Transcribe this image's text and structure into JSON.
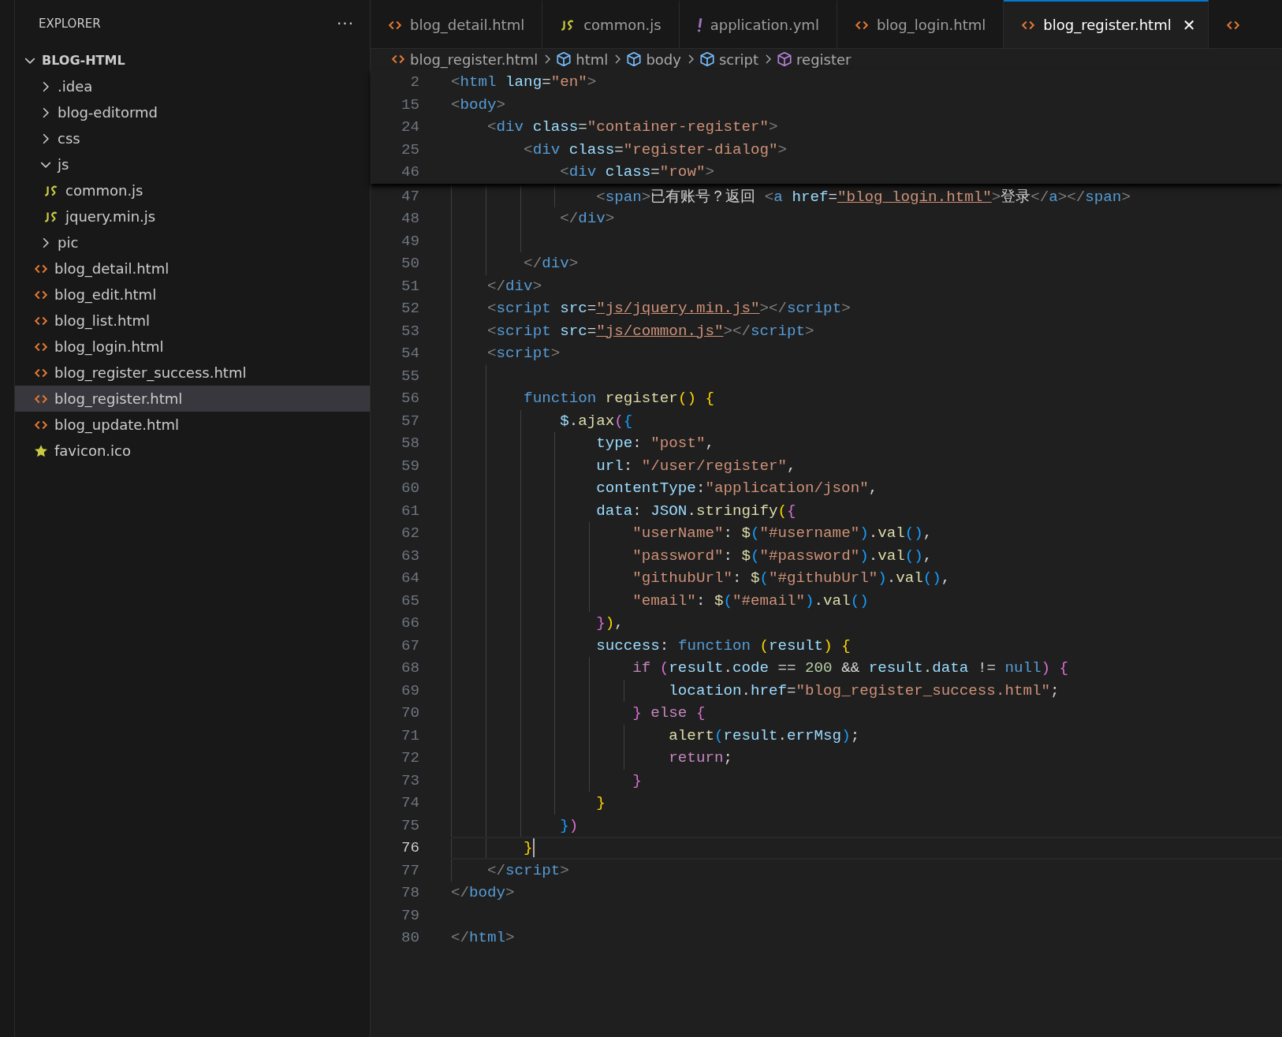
{
  "sidebar": {
    "title": "EXPLORER",
    "more": "···",
    "tree": [
      {
        "label": "BLOG-HTML",
        "kind": "root",
        "expanded": true,
        "selected": false,
        "children": [
          {
            "label": ".idea",
            "kind": "folder",
            "expanded": false,
            "selected": false
          },
          {
            "label": "blog-editormd",
            "kind": "folder",
            "expanded": false,
            "selected": false
          },
          {
            "label": "css",
            "kind": "folder",
            "expanded": false,
            "selected": false
          },
          {
            "label": "js",
            "kind": "folder",
            "expanded": true,
            "selected": false,
            "children": [
              {
                "label": "common.js",
                "kind": "js",
                "selected": false
              },
              {
                "label": "jquery.min.js",
                "kind": "js",
                "selected": false
              }
            ]
          },
          {
            "label": "pic",
            "kind": "folder",
            "expanded": false,
            "selected": false
          },
          {
            "label": "blog_detail.html",
            "kind": "html",
            "selected": false
          },
          {
            "label": "blog_edit.html",
            "kind": "html",
            "selected": false
          },
          {
            "label": "blog_list.html",
            "kind": "html",
            "selected": false
          },
          {
            "label": "blog_login.html",
            "kind": "html",
            "selected": false
          },
          {
            "label": "blog_register_success.html",
            "kind": "html",
            "selected": false
          },
          {
            "label": "blog_register.html",
            "kind": "html",
            "selected": true
          },
          {
            "label": "blog_update.html",
            "kind": "html",
            "selected": false
          },
          {
            "label": "favicon.ico",
            "kind": "star",
            "selected": false
          }
        ]
      }
    ]
  },
  "tabs": [
    {
      "label": "blog_detail.html",
      "kind": "html",
      "selected": false
    },
    {
      "label": "common.js",
      "kind": "js",
      "selected": false
    },
    {
      "label": "application.yml",
      "kind": "yaml",
      "selected": false
    },
    {
      "label": "blog_login.html",
      "kind": "html",
      "selected": false
    },
    {
      "label": "blog_register.html",
      "kind": "html",
      "selected": true,
      "close": "✕"
    },
    {
      "kind": "html",
      "selected": false
    }
  ],
  "breadcrumbs": [
    {
      "label": "blog_register.html",
      "kind": "html"
    },
    {
      "label": "html",
      "kind": "module"
    },
    {
      "label": "body",
      "kind": "module"
    },
    {
      "label": "script",
      "kind": "module"
    },
    {
      "label": "register",
      "kind": "function"
    }
  ],
  "sticky_lines": [
    {
      "number": "2",
      "tokens": [
        {
          "kind": "punct",
          "text": "<"
        },
        {
          "kind": "tag",
          "text": "html"
        },
        {
          "kind": "attr",
          "text": " lang"
        },
        {
          "kind": "text",
          "text": "="
        },
        {
          "kind": "str",
          "text": "\"en\""
        },
        {
          "kind": "punct",
          "text": ">"
        }
      ]
    },
    {
      "number": "15",
      "tokens": [
        {
          "kind": "punct",
          "text": "<"
        },
        {
          "kind": "tag",
          "text": "body"
        },
        {
          "kind": "punct",
          "text": ">"
        }
      ]
    },
    {
      "number": "24",
      "tokens": [
        {
          "kind": "punct",
          "text": "    <"
        },
        {
          "kind": "tag",
          "text": "div"
        },
        {
          "kind": "attr",
          "text": " class"
        },
        {
          "kind": "text",
          "text": "="
        },
        {
          "kind": "str",
          "text": "\"container-register\""
        },
        {
          "kind": "punct",
          "text": ">"
        }
      ]
    },
    {
      "number": "25",
      "tokens": [
        {
          "kind": "punct",
          "text": "        <"
        },
        {
          "kind": "tag",
          "text": "div"
        },
        {
          "kind": "attr",
          "text": " class"
        },
        {
          "kind": "text",
          "text": "="
        },
        {
          "kind": "str",
          "text": "\"register-dialog\""
        },
        {
          "kind": "punct",
          "text": ">"
        }
      ]
    },
    {
      "number": "46",
      "tokens": [
        {
          "kind": "punct",
          "text": "            <"
        },
        {
          "kind": "tag",
          "text": "div"
        },
        {
          "kind": "attr",
          "text": " class"
        },
        {
          "kind": "text",
          "text": "="
        },
        {
          "kind": "str",
          "text": "\"row\""
        },
        {
          "kind": "punct",
          "text": ">"
        }
      ]
    }
  ],
  "lines": [
    {
      "number": "47",
      "current": false,
      "tokens": [
        {
          "kind": "punct",
          "text": "                <"
        },
        {
          "kind": "tag",
          "text": "span"
        },
        {
          "kind": "punct",
          "text": ">"
        },
        {
          "kind": "text",
          "text": "已有账号？返回 "
        },
        {
          "kind": "punct",
          "text": "<"
        },
        {
          "kind": "tag",
          "text": "a"
        },
        {
          "kind": "attr",
          "text": " href"
        },
        {
          "kind": "text",
          "text": "="
        },
        {
          "kind": "link",
          "text": "\"blog_login.html\""
        },
        {
          "kind": "punct",
          "text": ">"
        },
        {
          "kind": "text",
          "text": "登录"
        },
        {
          "kind": "punct",
          "text": "</"
        },
        {
          "kind": "tag",
          "text": "a"
        },
        {
          "kind": "punct",
          "text": "></"
        },
        {
          "kind": "tag",
          "text": "span"
        },
        {
          "kind": "punct",
          "text": ">"
        }
      ]
    },
    {
      "number": "48",
      "current": false,
      "tokens": [
        {
          "kind": "punct",
          "text": "            </"
        },
        {
          "kind": "tag",
          "text": "div"
        },
        {
          "kind": "punct",
          "text": ">"
        }
      ]
    },
    {
      "number": "49",
      "current": false
    },
    {
      "number": "50",
      "current": false,
      "tokens": [
        {
          "kind": "punct",
          "text": "        </"
        },
        {
          "kind": "tag",
          "text": "div"
        },
        {
          "kind": "punct",
          "text": ">"
        }
      ]
    },
    {
      "number": "51",
      "current": false,
      "tokens": [
        {
          "kind": "punct",
          "text": "    </"
        },
        {
          "kind": "tag",
          "text": "div"
        },
        {
          "kind": "punct",
          "text": ">"
        }
      ]
    },
    {
      "number": "52",
      "current": false,
      "tokens": [
        {
          "kind": "punct",
          "text": "    <"
        },
        {
          "kind": "tag",
          "text": "script"
        },
        {
          "kind": "attr",
          "text": " src"
        },
        {
          "kind": "text",
          "text": "="
        },
        {
          "kind": "link",
          "text": "\"js/jquery.min.js\""
        },
        {
          "kind": "punct",
          "text": "></"
        },
        {
          "kind": "tag",
          "text": "script"
        },
        {
          "kind": "punct",
          "text": ">"
        }
      ]
    },
    {
      "number": "53",
      "current": false,
      "tokens": [
        {
          "kind": "punct",
          "text": "    <"
        },
        {
          "kind": "tag",
          "text": "script"
        },
        {
          "kind": "attr",
          "text": " src"
        },
        {
          "kind": "text",
          "text": "="
        },
        {
          "kind": "link",
          "text": "\"js/common.js\""
        },
        {
          "kind": "punct",
          "text": "></"
        },
        {
          "kind": "tag",
          "text": "script"
        },
        {
          "kind": "punct",
          "text": ">"
        }
      ]
    },
    {
      "number": "54",
      "current": false,
      "tokens": [
        {
          "kind": "punct",
          "text": "    <"
        },
        {
          "kind": "tag",
          "text": "script"
        },
        {
          "kind": "punct",
          "text": ">"
        }
      ]
    },
    {
      "number": "55",
      "current": false
    },
    {
      "number": "56",
      "current": false,
      "tokens": [
        {
          "kind": "kw",
          "text": "        function"
        },
        {
          "kind": "fn",
          "text": " register"
        },
        {
          "kind": "b1",
          "text": "()"
        },
        {
          "kind": "b1",
          "text": " {"
        }
      ]
    },
    {
      "number": "57",
      "current": false,
      "tokens": [
        {
          "kind": "var",
          "text": "            $"
        },
        {
          "kind": "text",
          "text": "."
        },
        {
          "kind": "fn",
          "text": "ajax"
        },
        {
          "kind": "b2",
          "text": "("
        },
        {
          "kind": "b3",
          "text": "{"
        }
      ]
    },
    {
      "number": "58",
      "current": false,
      "tokens": [
        {
          "kind": "var",
          "text": "                type"
        },
        {
          "kind": "text",
          "text": ": "
        },
        {
          "kind": "str",
          "text": "\"post\""
        },
        {
          "kind": "text",
          "text": ","
        }
      ]
    },
    {
      "number": "59",
      "current": false,
      "tokens": [
        {
          "kind": "var",
          "text": "                url"
        },
        {
          "kind": "text",
          "text": ": "
        },
        {
          "kind": "str",
          "text": "\"/user/register\""
        },
        {
          "kind": "text",
          "text": ","
        }
      ]
    },
    {
      "number": "60",
      "current": false,
      "tokens": [
        {
          "kind": "var",
          "text": "                contentType"
        },
        {
          "kind": "text",
          "text": ":"
        },
        {
          "kind": "str",
          "text": "\"application/json\""
        },
        {
          "kind": "text",
          "text": ","
        }
      ]
    },
    {
      "number": "61",
      "current": false,
      "tokens": [
        {
          "kind": "var",
          "text": "                data"
        },
        {
          "kind": "text",
          "text": ": "
        },
        {
          "kind": "var",
          "text": "JSON"
        },
        {
          "kind": "text",
          "text": "."
        },
        {
          "kind": "fn",
          "text": "stringify"
        },
        {
          "kind": "b1",
          "text": "("
        },
        {
          "kind": "b2",
          "text": "{"
        }
      ]
    },
    {
      "number": "62",
      "current": false,
      "tokens": [
        {
          "kind": "str",
          "text": "                    \"userName\""
        },
        {
          "kind": "text",
          "text": ": "
        },
        {
          "kind": "fn",
          "text": "$"
        },
        {
          "kind": "b3",
          "text": "("
        },
        {
          "kind": "str",
          "text": "\"#username\""
        },
        {
          "kind": "b3",
          "text": ")"
        },
        {
          "kind": "text",
          "text": "."
        },
        {
          "kind": "fn",
          "text": "val"
        },
        {
          "kind": "b3",
          "text": "()"
        },
        {
          "kind": "text",
          "text": ","
        }
      ]
    },
    {
      "number": "63",
      "current": false,
      "tokens": [
        {
          "kind": "str",
          "text": "                    \"password\""
        },
        {
          "kind": "text",
          "text": ": "
        },
        {
          "kind": "fn",
          "text": "$"
        },
        {
          "kind": "b3",
          "text": "("
        },
        {
          "kind": "str",
          "text": "\"#password\""
        },
        {
          "kind": "b3",
          "text": ")"
        },
        {
          "kind": "text",
          "text": "."
        },
        {
          "kind": "fn",
          "text": "val"
        },
        {
          "kind": "b3",
          "text": "()"
        },
        {
          "kind": "text",
          "text": ","
        }
      ]
    },
    {
      "number": "64",
      "current": false,
      "tokens": [
        {
          "kind": "str",
          "text": "                    \"githubUrl\""
        },
        {
          "kind": "text",
          "text": ": "
        },
        {
          "kind": "fn",
          "text": "$"
        },
        {
          "kind": "b3",
          "text": "("
        },
        {
          "kind": "str",
          "text": "\"#githubUrl\""
        },
        {
          "kind": "b3",
          "text": ")"
        },
        {
          "kind": "text",
          "text": "."
        },
        {
          "kind": "fn",
          "text": "val"
        },
        {
          "kind": "b3",
          "text": "()"
        },
        {
          "kind": "text",
          "text": ","
        }
      ]
    },
    {
      "number": "65",
      "current": false,
      "tokens": [
        {
          "kind": "str",
          "text": "                    \"email\""
        },
        {
          "kind": "text",
          "text": ": "
        },
        {
          "kind": "fn",
          "text": "$"
        },
        {
          "kind": "b3",
          "text": "("
        },
        {
          "kind": "str",
          "text": "\"#email\""
        },
        {
          "kind": "b3",
          "text": ")"
        },
        {
          "kind": "text",
          "text": "."
        },
        {
          "kind": "fn",
          "text": "val"
        },
        {
          "kind": "b3",
          "text": "()"
        }
      ]
    },
    {
      "number": "66",
      "current": false,
      "tokens": [
        {
          "kind": "b2",
          "text": "                }"
        },
        {
          "kind": "b1",
          "text": ")"
        },
        {
          "kind": "text",
          "text": ","
        }
      ]
    },
    {
      "number": "67",
      "current": false,
      "tokens": [
        {
          "kind": "var",
          "text": "                success"
        },
        {
          "kind": "text",
          "text": ": "
        },
        {
          "kind": "kw",
          "text": "function"
        },
        {
          "kind": "b1",
          "text": " ("
        },
        {
          "kind": "var",
          "text": "result"
        },
        {
          "kind": "b1",
          "text": ")"
        },
        {
          "kind": "b1",
          "text": " {"
        }
      ]
    },
    {
      "number": "68",
      "current": false,
      "tokens": [
        {
          "kind": "ctrl",
          "text": "                    if"
        },
        {
          "kind": "b2",
          "text": " ("
        },
        {
          "kind": "var",
          "text": "result"
        },
        {
          "kind": "text",
          "text": "."
        },
        {
          "kind": "var",
          "text": "code"
        },
        {
          "kind": "text",
          "text": " == "
        },
        {
          "kind": "num",
          "text": "200"
        },
        {
          "kind": "text",
          "text": " && "
        },
        {
          "kind": "var",
          "text": "result"
        },
        {
          "kind": "text",
          "text": "."
        },
        {
          "kind": "var",
          "text": "data"
        },
        {
          "kind": "text",
          "text": " != "
        },
        {
          "kind": "kw",
          "text": "null"
        },
        {
          "kind": "b2",
          "text": ")"
        },
        {
          "kind": "b2",
          "text": " {"
        }
      ]
    },
    {
      "number": "69",
      "current": false,
      "tokens": [
        {
          "kind": "var",
          "text": "                        location"
        },
        {
          "kind": "text",
          "text": "."
        },
        {
          "kind": "var",
          "text": "href"
        },
        {
          "kind": "text",
          "text": "="
        },
        {
          "kind": "str",
          "text": "\"blog_register_success.html\""
        },
        {
          "kind": "text",
          "text": ";"
        }
      ]
    },
    {
      "number": "70",
      "current": false,
      "tokens": [
        {
          "kind": "b2",
          "text": "                    }"
        },
        {
          "kind": "ctrl",
          "text": " else"
        },
        {
          "kind": "b2",
          "text": " {"
        }
      ]
    },
    {
      "number": "71",
      "current": false,
      "tokens": [
        {
          "kind": "fn",
          "text": "                        alert"
        },
        {
          "kind": "b3",
          "text": "("
        },
        {
          "kind": "var",
          "text": "result"
        },
        {
          "kind": "text",
          "text": "."
        },
        {
          "kind": "var",
          "text": "errMsg"
        },
        {
          "kind": "b3",
          "text": ")"
        },
        {
          "kind": "text",
          "text": ";"
        }
      ]
    },
    {
      "number": "72",
      "current": false,
      "tokens": [
        {
          "kind": "ctrl",
          "text": "                        return"
        },
        {
          "kind": "text",
          "text": ";"
        }
      ]
    },
    {
      "number": "73",
      "current": false,
      "tokens": [
        {
          "kind": "b2",
          "text": "                    }"
        }
      ]
    },
    {
      "number": "74",
      "current": false,
      "tokens": [
        {
          "kind": "b1",
          "text": "                }"
        }
      ]
    },
    {
      "number": "75",
      "current": false,
      "tokens": [
        {
          "kind": "b3",
          "text": "            }"
        },
        {
          "kind": "b2",
          "text": ")"
        }
      ]
    },
    {
      "number": "76",
      "current": true,
      "tokens": [
        {
          "kind": "b1",
          "text": "        }"
        }
      ]
    },
    {
      "number": "77",
      "current": false,
      "tokens": [
        {
          "kind": "punct",
          "text": "    </"
        },
        {
          "kind": "tag",
          "text": "script"
        },
        {
          "kind": "punct",
          "text": ">"
        }
      ]
    },
    {
      "number": "78",
      "current": false,
      "tokens": [
        {
          "kind": "punct",
          "text": "</"
        },
        {
          "kind": "tag",
          "text": "body"
        },
        {
          "kind": "punct",
          "text": ">"
        }
      ]
    },
    {
      "number": "79",
      "current": false
    },
    {
      "number": "80",
      "current": false,
      "tokens": [
        {
          "kind": "punct",
          "text": "</"
        },
        {
          "kind": "tag",
          "text": "html"
        },
        {
          "kind": "punct",
          "text": ">"
        }
      ]
    }
  ]
}
